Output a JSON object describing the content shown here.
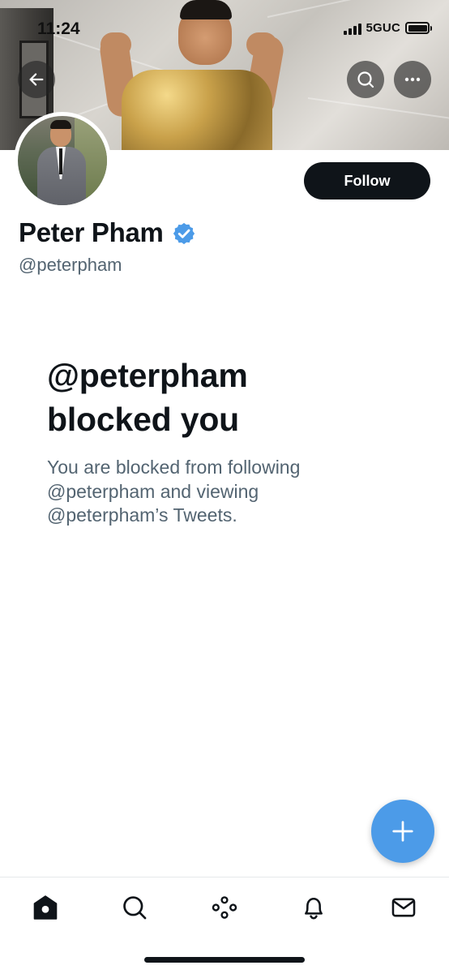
{
  "status_bar": {
    "time": "11:24",
    "network": "5GUC"
  },
  "header": {
    "back_icon": "arrow-left-icon",
    "search_icon": "search-icon",
    "more_icon": "more-horizontal-icon"
  },
  "profile": {
    "follow_label": "Follow",
    "display_name": "Peter Pham",
    "verified_icon": "verified-badge-icon",
    "verified_color": "#4c9be8",
    "handle": "@peterpham"
  },
  "blocked": {
    "title_line1": "@peterpham",
    "title_line2": "blocked you",
    "desc_line1": "You are blocked from following",
    "desc_line2": "@peterpham and viewing",
    "desc_line3": "@peterpham’s Tweets."
  },
  "fab": {
    "icon": "plus-icon",
    "color": "#4c9be8"
  },
  "tab_bar": {
    "items": [
      {
        "name": "home",
        "icon": "home-icon",
        "active": true
      },
      {
        "name": "explore",
        "icon": "search-icon",
        "active": false
      },
      {
        "name": "spaces",
        "icon": "spaces-icon",
        "active": false
      },
      {
        "name": "notifications",
        "icon": "bell-icon",
        "active": false
      },
      {
        "name": "messages",
        "icon": "envelope-icon",
        "active": false
      }
    ]
  },
  "colors": {
    "text_primary": "#0f1419",
    "text_secondary": "#536471",
    "button_dark": "#0f1419",
    "accent": "#4c9be8"
  }
}
